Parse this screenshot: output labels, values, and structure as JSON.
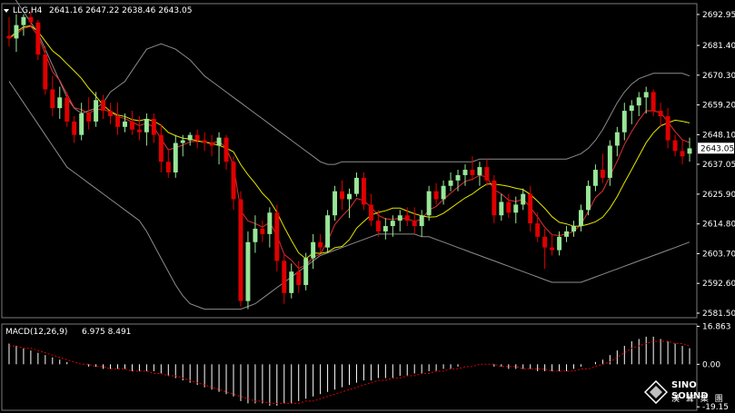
{
  "header": {
    "symbol": "LLG,H4",
    "ohlc": "2641.16 2647.22 2638.46 2643.05"
  },
  "macd_header": {
    "label": "MACD(12,26,9)",
    "values": "6.975 8.491"
  },
  "logo": {
    "name": "SINO SOUND",
    "sub": "漢 聲 集 團"
  },
  "colors": {
    "background": "#000000",
    "bull": "#98e698",
    "bear": "#e00000",
    "ma_fast": "#e03030",
    "ma_slow": "#e6e600",
    "bands": "#8c8c8c",
    "macd_hist": "#ffffff",
    "macd_signal": "#e00000",
    "current_price_bg": "#000000"
  },
  "chart_data": [
    {
      "type": "candlestick",
      "title": "LLG,H4",
      "ylim": [
        2579.8,
        2697.0
      ],
      "y_ticks": [
        "2692.95",
        "2681.40",
        "2670.30",
        "2659.20",
        "2648.10",
        "2637.05",
        "2625.90",
        "2614.80",
        "2603.70",
        "2592.60",
        "2581.50"
      ],
      "current_price": "2643.05",
      "candles": [
        [
          2685,
          2692,
          2681,
          2684
        ],
        [
          2684,
          2693,
          2679,
          2689
        ],
        [
          2689,
          2693,
          2685,
          2692
        ],
        [
          2692,
          2694,
          2688,
          2690
        ],
        [
          2690,
          2691,
          2676,
          2678
        ],
        [
          2678,
          2681,
          2663,
          2665
        ],
        [
          2665,
          2670,
          2655,
          2658
        ],
        [
          2658,
          2666,
          2654,
          2662
        ],
        [
          2662,
          2664,
          2651,
          2653
        ],
        [
          2653,
          2655,
          2645,
          2648
        ],
        [
          2648,
          2660,
          2646,
          2656
        ],
        [
          2656,
          2662,
          2650,
          2653
        ],
        [
          2653,
          2664,
          2651,
          2661
        ],
        [
          2661,
          2663,
          2654,
          2657
        ],
        [
          2657,
          2660,
          2652,
          2655
        ],
        [
          2655,
          2660,
          2648,
          2651
        ],
        [
          2651,
          2656,
          2649,
          2653
        ],
        [
          2653,
          2657,
          2648,
          2650
        ],
        [
          2650,
          2655,
          2646,
          2649
        ],
        [
          2649,
          2656,
          2644,
          2654
        ],
        [
          2654,
          2656,
          2645,
          2648
        ],
        [
          2648,
          2652,
          2634,
          2638
        ],
        [
          2638,
          2643,
          2632,
          2634
        ],
        [
          2634,
          2648,
          2632,
          2645
        ],
        [
          2645,
          2648,
          2640,
          2646
        ],
        [
          2646,
          2649,
          2644,
          2648
        ],
        [
          2648,
          2650,
          2643,
          2646
        ],
        [
          2646,
          2649,
          2642,
          2645
        ],
        [
          2645,
          2648,
          2640,
          2644
        ],
        [
          2644,
          2649,
          2637,
          2647
        ],
        [
          2647,
          2648,
          2635,
          2638
        ],
        [
          2638,
          2640,
          2620,
          2624
        ],
        [
          2624,
          2627,
          2584,
          2586
        ],
        [
          2586,
          2612,
          2583,
          2608
        ],
        [
          2608,
          2618,
          2604,
          2613
        ],
        [
          2613,
          2616,
          2608,
          2611
        ],
        [
          2611,
          2621,
          2606,
          2619
        ],
        [
          2619,
          2622,
          2597,
          2601
        ],
        [
          2601,
          2604,
          2585,
          2589
        ],
        [
          2589,
          2600,
          2587,
          2597
        ],
        [
          2597,
          2601,
          2589,
          2592
        ],
        [
          2592,
          2604,
          2590,
          2602
        ],
        [
          2602,
          2611,
          2598,
          2608
        ],
        [
          2608,
          2611,
          2604,
          2606
        ],
        [
          2606,
          2620,
          2604,
          2618
        ],
        [
          2618,
          2629,
          2616,
          2627
        ],
        [
          2627,
          2631,
          2620,
          2624
        ],
        [
          2624,
          2628,
          2617,
          2626
        ],
        [
          2626,
          2634,
          2625,
          2632
        ],
        [
          2632,
          2634,
          2620,
          2622
        ],
        [
          2622,
          2626,
          2614,
          2616
        ],
        [
          2616,
          2620,
          2610,
          2612
        ],
        [
          2612,
          2617,
          2609,
          2614
        ],
        [
          2614,
          2618,
          2610,
          2616
        ],
        [
          2616,
          2620,
          2612,
          2618
        ],
        [
          2618,
          2621,
          2614,
          2616
        ],
        [
          2616,
          2621,
          2611,
          2614
        ],
        [
          2614,
          2620,
          2610,
          2618
        ],
        [
          2618,
          2629,
          2616,
          2627
        ],
        [
          2627,
          2630,
          2622,
          2624
        ],
        [
          2624,
          2631,
          2622,
          2629
        ],
        [
          2629,
          2634,
          2627,
          2631
        ],
        [
          2631,
          2635,
          2627,
          2633
        ],
        [
          2633,
          2637,
          2629,
          2635
        ],
        [
          2635,
          2640,
          2631,
          2633
        ],
        [
          2633,
          2638,
          2629,
          2636
        ],
        [
          2636,
          2639,
          2629,
          2631
        ],
        [
          2631,
          2633,
          2615,
          2618
        ],
        [
          2618,
          2626,
          2616,
          2623
        ],
        [
          2623,
          2626,
          2617,
          2619
        ],
        [
          2619,
          2625,
          2615,
          2622
        ],
        [
          2622,
          2628,
          2620,
          2626
        ],
        [
          2626,
          2629,
          2612,
          2615
        ],
        [
          2615,
          2619,
          2608,
          2610
        ],
        [
          2610,
          2613,
          2598,
          2606
        ],
        [
          2606,
          2611,
          2603,
          2605
        ],
        [
          2605,
          2612,
          2603,
          2610
        ],
        [
          2610,
          2614,
          2608,
          2612
        ],
        [
          2612,
          2616,
          2610,
          2614
        ],
        [
          2614,
          2622,
          2612,
          2620
        ],
        [
          2620,
          2631,
          2618,
          2629
        ],
        [
          2629,
          2637,
          2627,
          2635
        ],
        [
          2635,
          2641,
          2630,
          2632
        ],
        [
          2632,
          2646,
          2629,
          2644
        ],
        [
          2644,
          2651,
          2640,
          2649
        ],
        [
          2649,
          2660,
          2646,
          2657
        ],
        [
          2657,
          2661,
          2652,
          2659
        ],
        [
          2659,
          2664,
          2655,
          2662
        ],
        [
          2662,
          2666,
          2656,
          2664
        ],
        [
          2664,
          2665,
          2655,
          2657
        ],
        [
          2657,
          2660,
          2651,
          2655
        ],
        [
          2655,
          2658,
          2643,
          2646
        ],
        [
          2646,
          2648,
          2640,
          2642
        ],
        [
          2642,
          2646,
          2637,
          2640
        ],
        [
          2641,
          2647,
          2638,
          2643
        ]
      ],
      "bands": {
        "upper": [
          2702,
          2698,
          2694,
          2690,
          2686,
          2680,
          2674,
          2668,
          2662,
          2658,
          2656,
          2657,
          2658,
          2660,
          2664,
          2666,
          2668,
          2672,
          2676,
          2680,
          2681,
          2682,
          2681,
          2680,
          2678,
          2676,
          2673,
          2670,
          2668,
          2666,
          2664,
          2662,
          2660,
          2658,
          2656,
          2654,
          2652,
          2650,
          2648,
          2646,
          2644,
          2642,
          2640,
          2638,
          2637,
          2637,
          2638,
          2638,
          2638,
          2638,
          2638,
          2638,
          2638,
          2638,
          2638,
          2638,
          2638,
          2638,
          2638,
          2638,
          2638,
          2638,
          2638,
          2638,
          2638,
          2639,
          2639,
          2639,
          2639,
          2639,
          2639,
          2639,
          2639,
          2639,
          2639,
          2639,
          2639,
          2639,
          2640,
          2641,
          2643,
          2646,
          2650,
          2655,
          2660,
          2664,
          2667,
          2669,
          2670,
          2671,
          2671,
          2671,
          2671,
          2671,
          2670
        ],
        "lower": [
          2668,
          2664,
          2660,
          2656,
          2652,
          2648,
          2644,
          2640,
          2636,
          2634,
          2632,
          2630,
          2628,
          2626,
          2624,
          2622,
          2620,
          2618,
          2616,
          2612,
          2607,
          2602,
          2597,
          2592,
          2588,
          2585,
          2584,
          2583,
          2583,
          2583,
          2583,
          2583,
          2583,
          2584,
          2585,
          2587,
          2589,
          2591,
          2593,
          2595,
          2597,
          2599,
          2601,
          2603,
          2604,
          2605,
          2606,
          2607,
          2608,
          2609,
          2610,
          2611,
          2611,
          2611,
          2611,
          2611,
          2611,
          2610,
          2610,
          2609,
          2608,
          2607,
          2606,
          2605,
          2604,
          2603,
          2602,
          2601,
          2600,
          2599,
          2598,
          2597,
          2596,
          2595,
          2594,
          2593,
          2593,
          2593,
          2593,
          2593,
          2594,
          2595,
          2596,
          2597,
          2598,
          2599,
          2600,
          2601,
          2602,
          2603,
          2604,
          2605,
          2606,
          2607,
          2608
        ]
      }
    },
    {
      "type": "bar+line",
      "title": "MACD(12,26,9)",
      "ylim": [
        -20.0,
        17.5
      ],
      "y_ticks": [
        "16.863",
        "0.00",
        "-19.15"
      ],
      "values": [
        9,
        8,
        7,
        6,
        5,
        4,
        3,
        2,
        1,
        0,
        0,
        -1,
        -1,
        -2,
        -2,
        -2,
        -2,
        -3,
        -3,
        -3,
        -3,
        -4,
        -5,
        -6,
        -7,
        -8,
        -9,
        -10,
        -11,
        -12,
        -13,
        -14,
        -16,
        -17,
        -17,
        -17,
        -18,
        -18,
        -17,
        -17,
        -16,
        -15,
        -14,
        -13,
        -12,
        -11,
        -10,
        -9,
        -8,
        -7,
        -7,
        -6,
        -6,
        -6,
        -5,
        -5,
        -4,
        -4,
        -3,
        -3,
        -2,
        -2,
        -1,
        0,
        0,
        0,
        0,
        -1,
        -1,
        -2,
        -2,
        -2,
        -2,
        -3,
        -3,
        -3,
        -3,
        -3,
        -2,
        -1,
        0,
        1,
        2,
        4,
        6,
        8,
        10,
        11,
        12,
        12,
        11,
        10,
        9,
        8,
        7
      ],
      "signal": [
        8,
        8,
        7,
        7,
        6,
        5,
        4,
        3,
        2,
        1,
        0,
        0,
        -1,
        -1,
        -2,
        -2,
        -2,
        -3,
        -3,
        -3,
        -4,
        -4,
        -5,
        -5,
        -6,
        -7,
        -8,
        -9,
        -10,
        -11,
        -12,
        -13,
        -14,
        -15,
        -16,
        -16,
        -17,
        -17,
        -17,
        -17,
        -17,
        -16,
        -16,
        -15,
        -14,
        -13,
        -12,
        -11,
        -10,
        -9,
        -8,
        -7,
        -7,
        -6,
        -6,
        -5,
        -5,
        -4,
        -4,
        -3,
        -3,
        -2,
        -2,
        -1,
        -1,
        0,
        0,
        0,
        -1,
        -1,
        -1,
        -2,
        -2,
        -2,
        -2,
        -3,
        -3,
        -3,
        -3,
        -2,
        -2,
        -1,
        0,
        1,
        3,
        5,
        7,
        8,
        9,
        10,
        10,
        10,
        9,
        9,
        8
      ]
    }
  ]
}
